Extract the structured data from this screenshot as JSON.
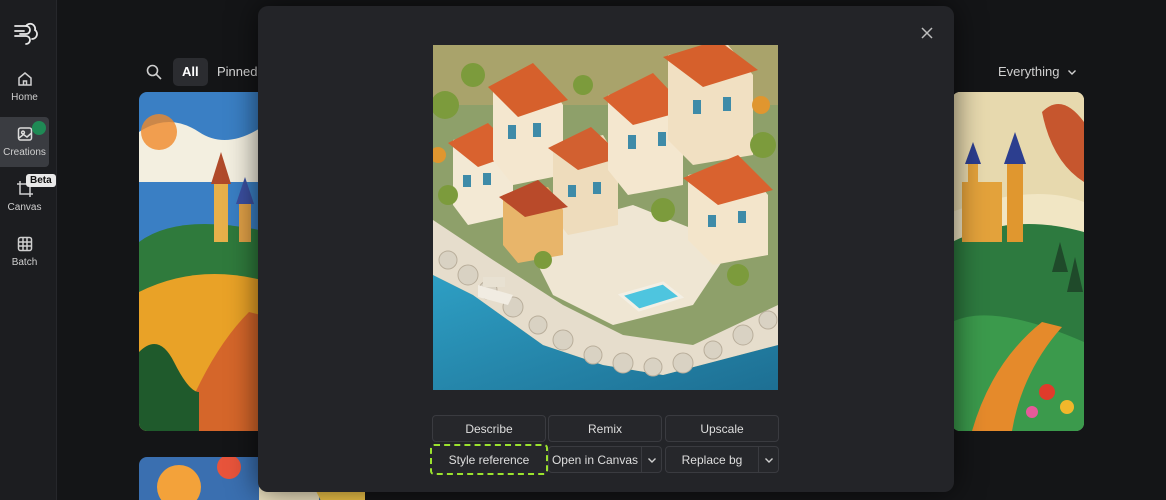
{
  "sidebar": {
    "items": [
      {
        "label": "Home"
      },
      {
        "label": "Creations"
      },
      {
        "label": "Canvas",
        "badge": "Beta"
      },
      {
        "label": "Batch"
      }
    ]
  },
  "gallery": {
    "tabs": [
      {
        "label": "All"
      },
      {
        "label": "Pinned"
      }
    ],
    "filter": "Everything"
  },
  "modal": {
    "actions": {
      "describe": "Describe",
      "remix": "Remix",
      "upscale": "Upscale",
      "style_reference": "Style reference",
      "open_in_canvas": "Open in Canvas",
      "replace_bg": "Replace bg"
    }
  },
  "colors": {
    "accent_highlight": "#9be22e",
    "active_dot": "#1f8a55"
  }
}
